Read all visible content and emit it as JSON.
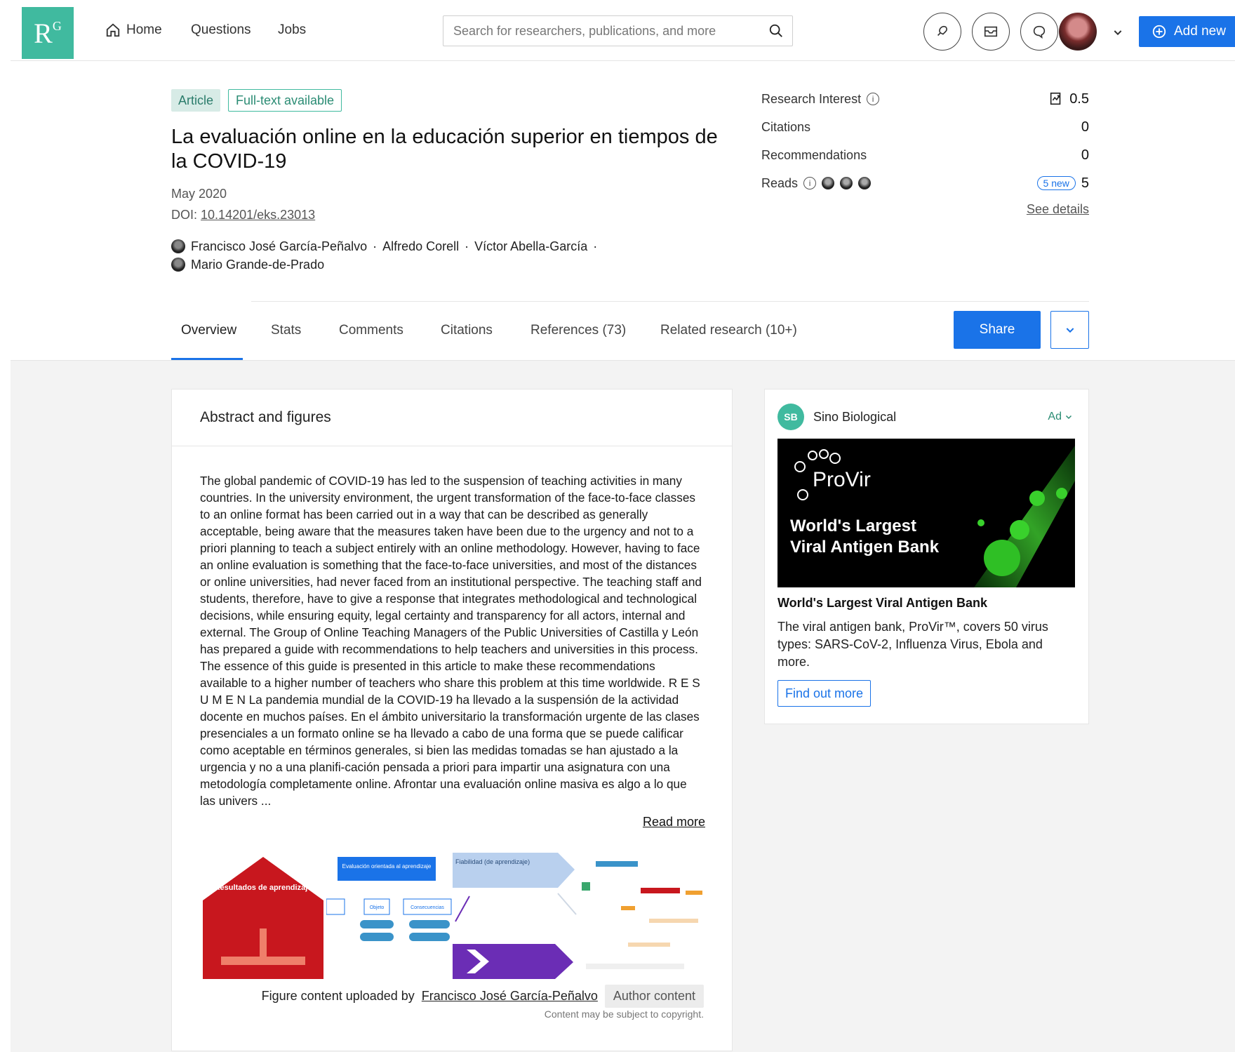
{
  "header": {
    "logo_text": "R",
    "logo_sup": "G",
    "nav": {
      "home": "Home",
      "questions": "Questions",
      "jobs": "Jobs"
    },
    "search_placeholder": "Search for researchers, publications, and more",
    "add_new": "Add new",
    "icons": [
      "home-icon",
      "search-icon",
      "notifications-icon",
      "messages-icon",
      "chat-icon",
      "chevron-down-icon",
      "plus-circle-icon"
    ]
  },
  "article": {
    "type_badge": "Article",
    "fulltext_badge": "Full-text available",
    "title": "La evaluación online en la educación superior en tiempos de la COVID-19",
    "date": "May 2020",
    "doi_label": "DOI:",
    "doi": "10.14201/eks.23013",
    "authors_line1": [
      "Francisco José García-Peñalvo",
      "Alfredo Corell",
      "Víctor Abella-García"
    ],
    "authors_line2": [
      "Mario Grande-de-Prado"
    ],
    "separator": "·"
  },
  "stats": {
    "research_interest_label": "Research Interest",
    "research_interest_value": "0.5",
    "citations_label": "Citations",
    "citations_value": "0",
    "recommendations_label": "Recommendations",
    "recommendations_value": "0",
    "reads_label": "Reads",
    "reads_new": "5 new",
    "reads_value": "5",
    "see_details": "See details"
  },
  "tabs": {
    "overview": "Overview",
    "stats": "Stats",
    "comments": "Comments",
    "citations": "Citations",
    "references": "References (73)",
    "related": "Related research (10+)",
    "share": "Share"
  },
  "abstract": {
    "heading": "Abstract and figures",
    "text": "The global pandemic of COVID-19 has led to the suspension of teaching activities in many countries. In the university environment, the urgent transformation of the face-to-face classes to an online format has been carried out in a way that can be described as generally acceptable, being aware that the measures taken have been due to the urgency and not to a priori planning to teach a subject entirely with an online methodology. However, having to face an online evaluation is something that the face-to-face universities, and most of the distances or online universities, had never faced from an institutional perspective. The teaching staff and students, therefore, have to give a response that integrates methodological and technological decisions, while ensuring equity, legal certainty and transparency for all actors, internal and external. The Group of Online Teaching Managers of the Public Universities of Castilla y León has prepared a guide with recommendations to help teachers and universities in this process. The essence of this guide is presented in this article to make these recommendations available to a higher number of teachers who share this problem at this time worldwide. R E S U M E N La pandemia mundial de la COVID-19 ha llevado a la suspensión de la actividad docente en muchos países. En el ámbito universitario la transformación urgente de las clases presenciales a un formato online se ha llevado a cabo de una forma que se puede calificar como aceptable en términos generales, si bien las medidas tomadas se han ajustado a la urgencia y no a una planifi-cación pensada a priori para impartir una asignatura con una metodología completamente online. Afrontar una evaluación online masiva es algo a lo que las univers ...",
    "read_more": "Read more",
    "figure_labels": {
      "fig1_text": "Resultados de aprendizaje",
      "fig2_text": "Evaluación orientada al aprendizaje",
      "fig2_box1": "Objeto",
      "fig2_box2": "Consecuencias",
      "fig3_text": "Fiabilidad (de aprendizaje)"
    },
    "caption_prefix": "Figure content uploaded by",
    "caption_author": "Francisco José García-Peñalvo",
    "author_content": "Author content",
    "copyright": "Content may be subject to copyright."
  },
  "ad": {
    "logo": "SB",
    "brand": "Sino Biological",
    "tag": "Ad",
    "image_brand": "ProVir",
    "image_tagline_1": "World's Largest",
    "image_tagline_2": "Viral Antigen Bank",
    "headline": "World's Largest Viral Antigen Bank",
    "body": "The viral antigen bank, ProVir™, covers 50 virus types: SARS-CoV-2, Influenza Virus, Ebola and more.",
    "cta": "Find out more"
  },
  "colors": {
    "brand_green": "#40ba9f",
    "primary_blue": "#1a73e8",
    "figure_red": "#c8171e",
    "figure_purple": "#6b2db5"
  }
}
